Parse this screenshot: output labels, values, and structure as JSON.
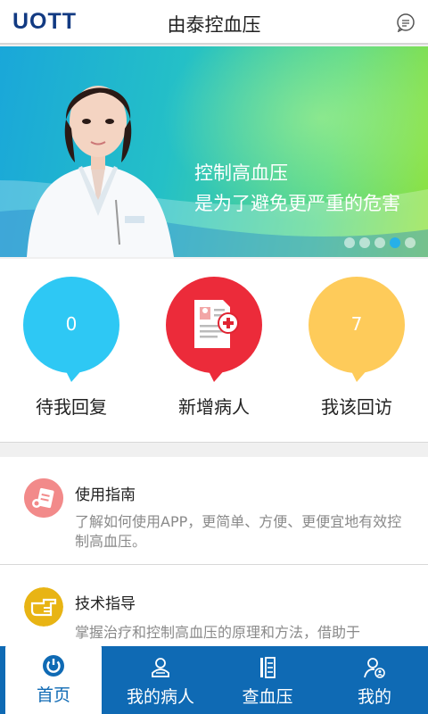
{
  "header": {
    "logo": "UOTT",
    "title": "由泰控血压"
  },
  "banner": {
    "line1": "控制高血压",
    "line2": "是为了避免更严重的危害",
    "slide_count": 5,
    "active_slide": 4
  },
  "quick_actions": [
    {
      "count": "0",
      "label": "待我回复",
      "color": "#2ec8f4"
    },
    {
      "count": "",
      "label": "新增病人",
      "color": "#ec2b3a"
    },
    {
      "count": "7",
      "label": "我该回访",
      "color": "#fecb5a"
    }
  ],
  "list": {
    "items": [
      {
        "title": "使用指南",
        "desc": "了解如何使用APP，更简单、方便、更便宜地有效控制高血压。"
      },
      {
        "title": "技术指导",
        "desc": "掌握治疗和控制高血压的原理和方法，借助于"
      }
    ]
  },
  "tabs": [
    {
      "label": "首页",
      "icon": "home-power-icon",
      "active": true
    },
    {
      "label": "我的病人",
      "icon": "patients-icon",
      "active": false
    },
    {
      "label": "查血压",
      "icon": "blood-pressure-icon",
      "active": false
    },
    {
      "label": "我的",
      "icon": "profile-icon",
      "active": false
    }
  ],
  "colors": {
    "tabbar": "#0f6ab4",
    "logo": "#123a82",
    "accent_blue": "#27b0e8"
  }
}
